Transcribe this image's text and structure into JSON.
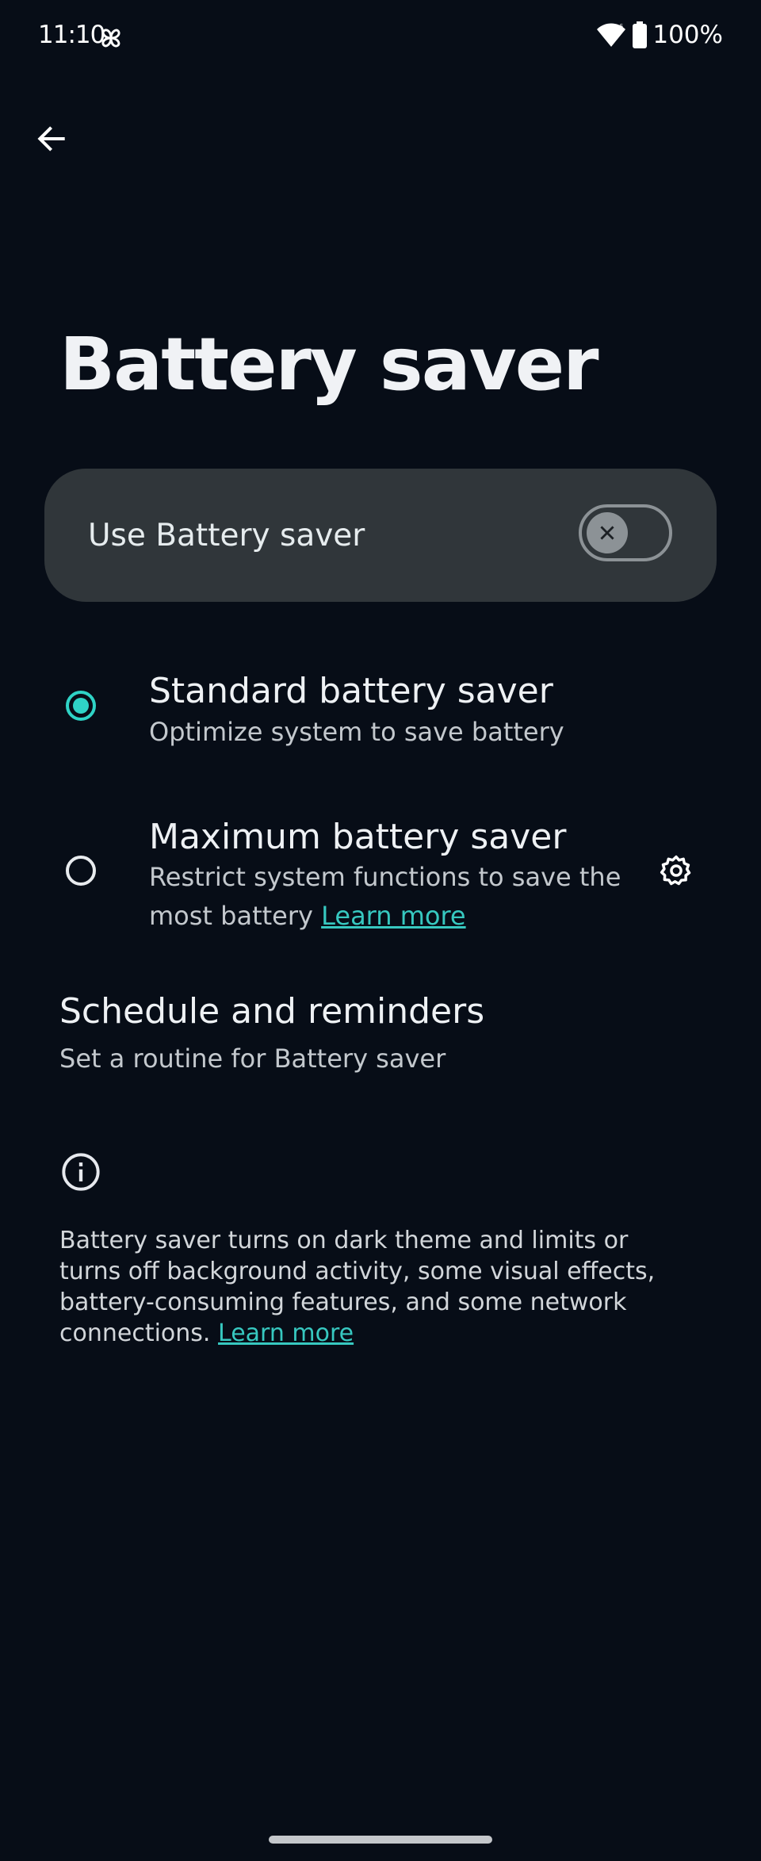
{
  "status_bar": {
    "time": "11:10",
    "battery_percent": "100%",
    "notification_icon": "fan-icon",
    "wifi_icon": "wifi-icon",
    "battery_icon": "battery-full-icon"
  },
  "header": {
    "back_icon": "arrow-back-icon",
    "title": "Battery saver"
  },
  "main_toggle": {
    "label": "Use Battery saver",
    "state": "off"
  },
  "options": [
    {
      "title": "Standard battery saver",
      "summary": "Optimize system to save battery",
      "selected": true
    },
    {
      "title": "Maximum battery saver",
      "summary": "Restrict system functions to save the most battery",
      "link": "Learn more",
      "selected": false,
      "settings_icon": "gear-icon"
    }
  ],
  "schedule": {
    "title": "Schedule and reminders",
    "summary": "Set a routine for Battery saver"
  },
  "footer": {
    "info_icon": "info-icon",
    "text": "Battery saver turns on dark theme and limits or turns off background activity, some visual effects, battery-consuming features, and some network connections.",
    "link": "Learn more"
  },
  "colors": {
    "background": "#070d17",
    "card": "#30363a",
    "accent": "#2fd3c6"
  }
}
